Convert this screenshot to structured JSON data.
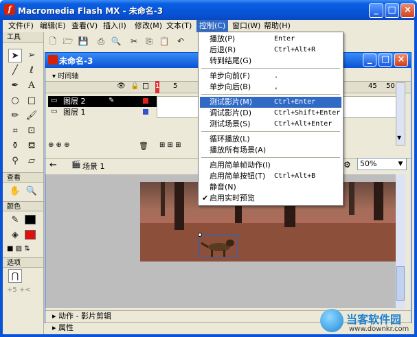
{
  "window": {
    "title": "Macromedia Flash MX - 未命名-3",
    "logo": "f",
    "min": "_",
    "max": "□",
    "close": "×"
  },
  "menubar": [
    {
      "label": "文件(F)"
    },
    {
      "label": "编辑(E)"
    },
    {
      "label": "查看(V)"
    },
    {
      "label": "插入(I)"
    },
    {
      "label": "修改(M)"
    },
    {
      "label": "文本(T)"
    },
    {
      "label": "控制(C)"
    },
    {
      "label": "窗口(W)"
    },
    {
      "label": "帮助(H)"
    }
  ],
  "tools_panel": {
    "header": "工具",
    "view_section": "查看",
    "colors_section": "颜色",
    "options_section": "选项"
  },
  "document": {
    "title": "未命名-3"
  },
  "timeline": {
    "header": "时间轴",
    "frame_numbers": [
      "1",
      "5",
      "45",
      "50"
    ],
    "layers": [
      {
        "name": "图层 2"
      },
      {
        "name": "图层 1"
      }
    ],
    "scene_label": "场景 1",
    "zoom": "50%"
  },
  "control_menu": {
    "items": [
      {
        "label": "播放(P)",
        "shortcut": "Enter"
      },
      {
        "label": "后退(R)",
        "shortcut": "Ctrl+Alt+R"
      },
      {
        "label": "转到结尾(G)",
        "shortcut": ""
      },
      {
        "label": "单步向前(F)",
        "shortcut": "."
      },
      {
        "label": "单步向后(B)",
        "shortcut": ","
      },
      {
        "label": "测试影片(M)",
        "shortcut": "Ctrl+Enter"
      },
      {
        "label": "调试影片(D)",
        "shortcut": "Ctrl+Shift+Enter"
      },
      {
        "label": "测试场景(S)",
        "shortcut": "Ctrl+Alt+Enter"
      },
      {
        "label": "循环播放(L)",
        "shortcut": ""
      },
      {
        "label": "播放所有场景(A)",
        "shortcut": ""
      },
      {
        "label": "启用简单帧动作(I)",
        "shortcut": ""
      },
      {
        "label": "启用简单按钮(T)",
        "shortcut": "Ctrl+Alt+B"
      },
      {
        "label": "静音(N)",
        "shortcut": ""
      },
      {
        "label": "启用实时预览",
        "shortcut": ""
      }
    ]
  },
  "bottom_panels": {
    "actions": "动作 - 影片剪辑",
    "properties": "属性"
  },
  "watermark": {
    "text": "当客软件园",
    "url": "www.downkr.com"
  }
}
